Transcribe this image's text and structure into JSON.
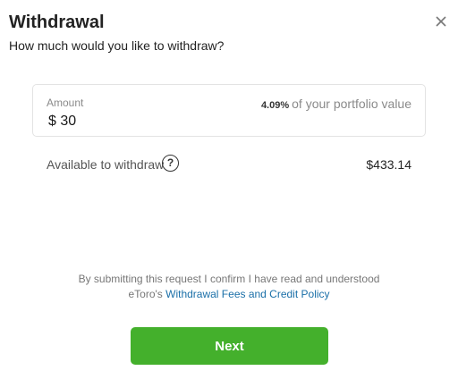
{
  "header": {
    "title": "Withdrawal",
    "subtitle": "How much would you like to withdraw?",
    "close_icon": "close-icon"
  },
  "amount": {
    "label": "Amount",
    "value": "$ 30",
    "portfolio_percent": "4.09%",
    "portfolio_text": "of your portfolio value"
  },
  "available": {
    "label": "Available to withdraw",
    "help_icon": "question-circle-icon",
    "help_symbol": "?",
    "value": "$433.14"
  },
  "disclaimer": {
    "line1": "By submitting this request I confirm I have read and understood",
    "prefix": "eToro's",
    "link_text": "Withdrawal Fees and Credit Policy"
  },
  "actions": {
    "next_label": "Next"
  },
  "colors": {
    "accent_green": "#44b02c",
    "link_blue": "#1a6fa8"
  }
}
